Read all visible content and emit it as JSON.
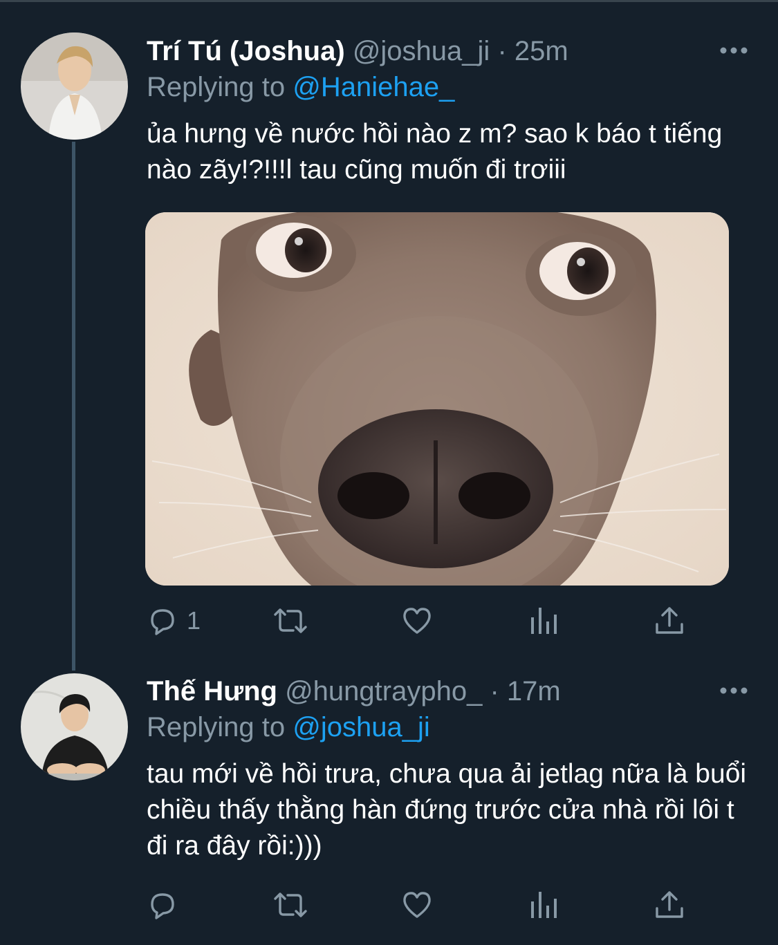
{
  "tweets": [
    {
      "display_name": "Trí Tú (Joshua)",
      "handle": "@joshua_ji",
      "dot": "·",
      "time": "25m",
      "replying_prefix": "Replying to",
      "replying_to": "@Haniehae_",
      "text": "ủa hưng về nước hồi nào z m? sao k báo t tiếng nào zãy!?!!!l tau cũng muốn đi trơiii",
      "media": "dog-closeup-photo",
      "reply_count": "1",
      "icons": [
        "reply-icon",
        "retweet-icon",
        "like-icon",
        "stats-icon",
        "share-icon",
        "more-icon"
      ]
    },
    {
      "display_name": "Thế Hưng",
      "handle": "@hungtraypho_",
      "dot": "·",
      "time": "17m",
      "replying_prefix": "Replying to",
      "replying_to": "@joshua_ji",
      "text": "tau mới về hồi trưa, chưa qua ải jetlag nữa là buổi chiều thấy thằng hàn đứng trước cửa nhà rồi lôi t đi ra đây rồi:)))",
      "reply_count": "",
      "icons": [
        "reply-icon",
        "retweet-icon",
        "like-icon",
        "stats-icon",
        "share-icon",
        "more-icon"
      ]
    }
  ],
  "colors": {
    "background": "#15202b",
    "text": "#ffffff",
    "secondary": "#8899a6",
    "accent": "#1da1f2",
    "thread_line": "#3d5466"
  }
}
